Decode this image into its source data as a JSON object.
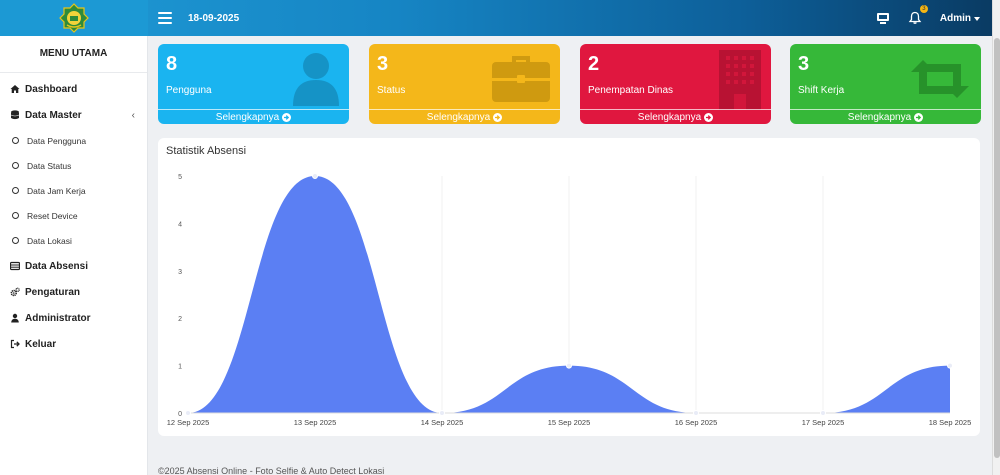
{
  "topbar": {
    "date": "18-09-2025",
    "notification_count": "3",
    "user_label": "Admin"
  },
  "sidebar": {
    "title": "MENU UTAMA",
    "items": [
      {
        "label": "Dashboard",
        "icon": "home-icon"
      },
      {
        "label": "Data Master",
        "icon": "database-icon"
      },
      {
        "label": "Data Absensi",
        "icon": "table-icon"
      },
      {
        "label": "Pengaturan",
        "icon": "gears-icon"
      },
      {
        "label": "Administrator",
        "icon": "user-icon"
      },
      {
        "label": "Keluar",
        "icon": "sign-out-icon"
      }
    ],
    "sub_items": [
      {
        "label": "Data Pengguna"
      },
      {
        "label": "Data Status"
      },
      {
        "label": "Data Jam Kerja"
      },
      {
        "label": "Reset Device"
      },
      {
        "label": "Data Lokasi"
      }
    ]
  },
  "cards": [
    {
      "value": "8",
      "label": "Pengguna",
      "link": "Selengkapnya",
      "color": "#1ab4f0",
      "icon": "user-icon"
    },
    {
      "value": "3",
      "label": "Status",
      "link": "Selengkapnya",
      "color": "#f4b71a",
      "icon": "briefcase-icon"
    },
    {
      "value": "2",
      "label": "Penempatan Dinas",
      "link": "Selengkapnya",
      "color": "#e0173f",
      "icon": "building-icon"
    },
    {
      "value": "3",
      "label": "Shift Kerja",
      "link": "Selengkapnya",
      "color": "#36b839",
      "icon": "retweet-icon"
    }
  ],
  "chart_data": {
    "type": "area",
    "title": "Statistik Absensi",
    "x": [
      "12 Sep 2025",
      "13 Sep 2025",
      "14 Sep 2025",
      "15 Sep 2025",
      "16 Sep 2025",
      "17 Sep 2025",
      "18 Sep 2025"
    ],
    "series": [
      {
        "values": [
          0,
          5,
          0,
          1,
          0,
          0,
          1
        ],
        "color": "#5b7ff3"
      }
    ],
    "ylim": [
      0,
      5
    ],
    "yticks": [
      "0",
      "1",
      "2",
      "3",
      "4",
      "5"
    ],
    "grid": true
  },
  "footer": {
    "text": "©2025 Absensi Online - Foto Selfie & Auto Detect Lokasi"
  }
}
